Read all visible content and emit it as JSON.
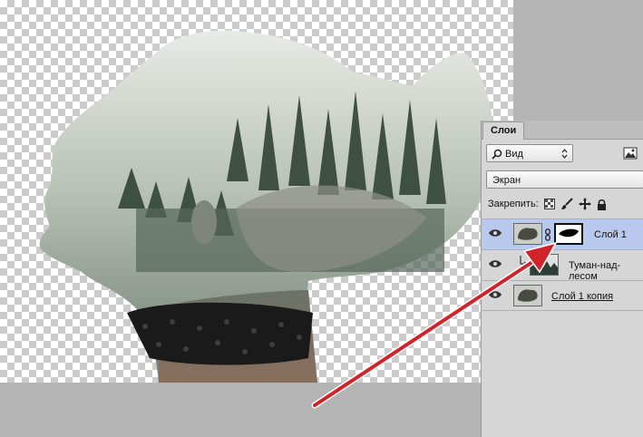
{
  "panel": {
    "tab_label": "Слои",
    "filter_label": "Вид",
    "blend_mode": "Экран",
    "lock_label": "Закрепить:"
  },
  "layers": [
    {
      "name": "Слой 1",
      "active": true
    },
    {
      "name": "Туман-над-лесом",
      "active": false
    },
    {
      "name": "Слой 1 копия",
      "active": false
    }
  ],
  "colors": {
    "arrow": "#d2222a",
    "selection": "#b9c9ee"
  }
}
